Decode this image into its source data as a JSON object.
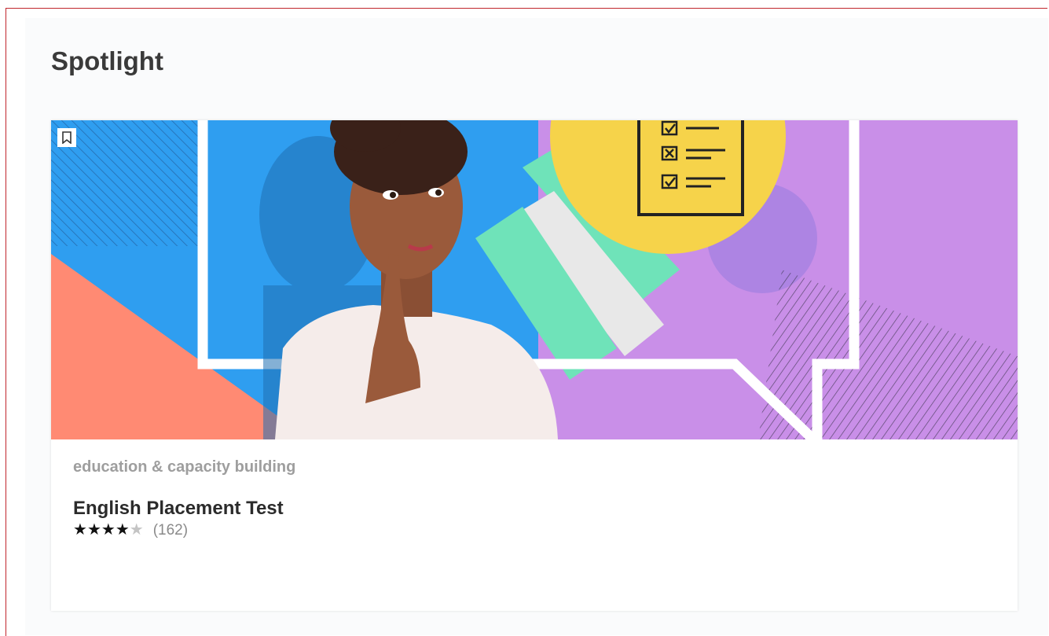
{
  "section": {
    "title": "Spotlight"
  },
  "card": {
    "category": "education & capacity building",
    "title": "English Placement Test",
    "rating": {
      "value": 4,
      "max": 5,
      "count_label": "(162)"
    },
    "image_alt": "Woman thinking beside a checklist speech bubble",
    "checklist_marks": [
      "check",
      "cross",
      "check"
    ],
    "bookmark_icon": "bookmark-icon"
  },
  "colors": {
    "frame_border": "#c0262d",
    "blue": "#2f9ef0",
    "salmon": "#ff8a73",
    "purple": "#c98fe8",
    "yellow": "#f6d34a",
    "mint": "#6fe3b9"
  }
}
